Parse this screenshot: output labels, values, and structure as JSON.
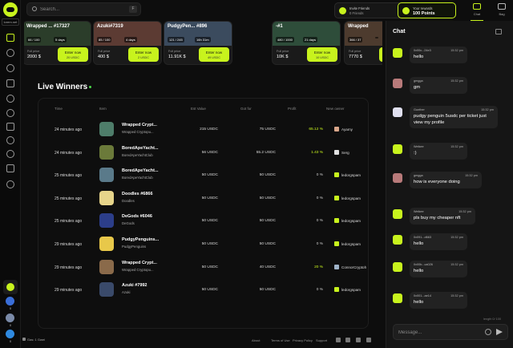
{
  "sidebar": {
    "logo_text": "lorem.net",
    "coins": [
      "0",
      "0",
      "0"
    ]
  },
  "topbar": {
    "search_placeholder": "Search...",
    "search_key": "F",
    "invite": {
      "label": "Invite Friends",
      "value": "0 Friends"
    },
    "rewards": {
      "label": "Your rewards",
      "value": "100 Points"
    },
    "chat_label": "Chat",
    "bag_label": "Bag"
  },
  "cards": [
    {
      "name": "Wrapped ... #17327",
      "stat1": "66 / 100",
      "stat2": "5 days",
      "fp_label": "Full price",
      "price": "2000 $",
      "enter": "Enter now",
      "enter_sub": "20 USDC",
      "color": "#2b3d2a"
    },
    {
      "name": "Azuki#7319",
      "stat1": "85 / 100",
      "stat2": "4 days",
      "fp_label": "Full price",
      "price": "400 $",
      "enter": "Enter now",
      "enter_sub": "2 USDC",
      "color": "#5c3b33"
    },
    {
      "name": "PudgyPen... #896",
      "stat1": "121 / 245",
      "stat2": "16h 31m",
      "fp_label": "Full price",
      "price": "11.91K $",
      "enter": "Enter now",
      "enter_sub": "49 USDC",
      "color": "#3b4b5e"
    },
    {
      "name": "-#1",
      "stat1": "480 / 1000",
      "stat2": "21 days",
      "fp_label": "Full price",
      "price": "10K $",
      "enter": "Enter now",
      "enter_sub": "10 USDC",
      "color": "#2e4d3a"
    },
    {
      "name": "Wrapped",
      "stat1": "366 / 37",
      "stat2": "",
      "fp_label": "Full price",
      "price": "7770 $",
      "enter": "Enter",
      "enter_sub": "",
      "color": "#4d3b2e"
    }
  ],
  "live_winners": {
    "title": "Live Winners",
    "headers": {
      "time": "Time",
      "item": "Item",
      "est": "Est Value",
      "got": "Got for",
      "profit": "Profit",
      "owner": "New owner"
    },
    "rows": [
      {
        "time": "24 minutes ago",
        "name": "Wrapped Crypt...",
        "collection": "Wrapped Cryptopu...",
        "est": "215 USDC",
        "got": "75 USDC",
        "profit": "65.12 %",
        "owner": "Ayamy",
        "thumb": "#4e7d6a",
        "avatar": "#d9a68a",
        "positive": true
      },
      {
        "time": "24 minutes ago",
        "name": "BoredApeYacht...",
        "collection": "BoredApeYachtClub",
        "est": "56 USDC",
        "got": "55.2 USDC",
        "profit": "1.43 %",
        "owner": "Serg",
        "thumb": "#6b7a3a",
        "avatar": "#e0e0e0",
        "positive": true
      },
      {
        "time": "25 minutes ago",
        "name": "BoredApeYacht...",
        "collection": "BoredApeYachtClub",
        "est": "50 USDC",
        "got": "50 USDC",
        "profit": "0 %",
        "owner": "ledorgspam",
        "thumb": "#5a7a8a",
        "avatar": "#c8f31d",
        "positive": false
      },
      {
        "time": "25 minutes ago",
        "name": "Doodles #6866",
        "collection": "Doodles",
        "est": "50 USDC",
        "got": "50 USDC",
        "profit": "0 %",
        "owner": "ledorgspam",
        "thumb": "#e6d48a",
        "avatar": "#c8f31d",
        "positive": false
      },
      {
        "time": "25 minutes ago",
        "name": "DeGods #6046",
        "collection": "DeGods",
        "est": "50 USDC",
        "got": "50 USDC",
        "profit": "0 %",
        "owner": "ledorgspam",
        "thumb": "#2c3e8a",
        "avatar": "#c8f31d",
        "positive": false
      },
      {
        "time": "29 minutes ago",
        "name": "PudgyPenguins...",
        "collection": "PudgyPenguins",
        "est": "50 USDC",
        "got": "50 USDC",
        "profit": "0 %",
        "owner": "ledorgspam",
        "thumb": "#e8c84a",
        "avatar": "#c8f31d",
        "positive": false
      },
      {
        "time": "29 minutes ago",
        "name": "Wrapped Crypt...",
        "collection": "Wrapped Cryptopu...",
        "est": "50 USDC",
        "got": "40 USDC",
        "profit": "20 %",
        "owner": "ConnorCryptoh",
        "thumb": "#8a6a4a",
        "avatar": "#9fb3c8",
        "positive": true
      },
      {
        "time": "29 minutes ago",
        "name": "Azuki #7992",
        "collection": "Azuki",
        "est": "50 USDC",
        "got": "50 USDC",
        "profit": "0 %",
        "owner": "ledorgspam",
        "thumb": "#3a4a6a",
        "avatar": "#c8f31d",
        "positive": false
      }
    ]
  },
  "footer": {
    "gas": "Gas: 1 Gwei",
    "links": [
      "About",
      "Terms of Use",
      "Privacy Policy",
      "Support"
    ]
  },
  "chat": {
    "title": "Chat",
    "messages": [
      {
        "user": "0x00c...24e3",
        "time": "15:32 pm",
        "text": "hello",
        "avatar": "#c8f31d"
      },
      {
        "user": "gmgga",
        "time": "15:32 pm",
        "text": "gm",
        "avatar": "#b87a7a"
      },
      {
        "user": "Gunther",
        "time": "15:32 pm",
        "text": "pudgy penguin 5usdc per ticket just view my profile",
        "avatar": "#e0e0f0"
      },
      {
        "user": "Weikee",
        "time": "15:32 pm",
        "text": ":)",
        "avatar": "#c8f31d"
      },
      {
        "user": "gmgga",
        "time": "15:32 pm",
        "text": "how is everyone doing",
        "avatar": "#b87a7a"
      },
      {
        "user": "Weikee",
        "time": "15:32 pm",
        "text": "pls buy my cheaper nft",
        "avatar": "#c8f31d"
      },
      {
        "user": "0x091...d663",
        "time": "15:32 pm",
        "text": "hello",
        "avatar": "#c8f31d"
      },
      {
        "user": "0x00b...ca026",
        "time": "15:32 pm",
        "text": "hello",
        "avatar": "#c8f31d"
      },
      {
        "user": "0x001...ae14",
        "time": "15:32 pm",
        "text": "hello",
        "avatar": "#c8f31d"
      }
    ],
    "footer_note": "length 0/ 100",
    "input_placeholder": "Message..."
  }
}
